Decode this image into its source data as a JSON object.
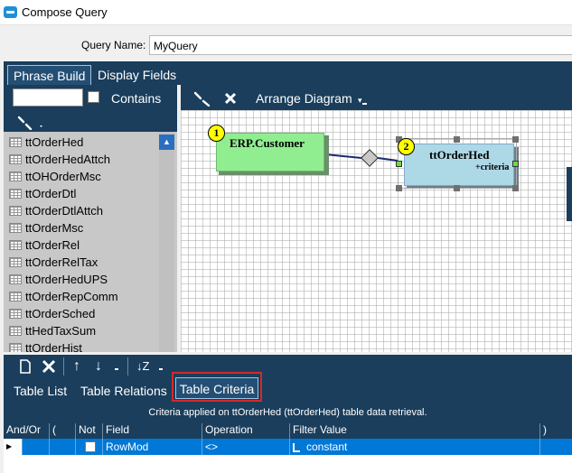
{
  "window": {
    "title": "Compose Query"
  },
  "query": {
    "label": "Query Name:",
    "value": "MyQuery"
  },
  "main_tabs": [
    {
      "label": "Phrase Build",
      "active": true
    },
    {
      "label": "Display Fields",
      "active": false
    }
  ],
  "left": {
    "contains_label": "Contains",
    "tables": [
      "ttOrderHed",
      "ttOrderHedAttch",
      "ttOHOrderMsc",
      "ttOrderDtl",
      "ttOrderDtlAttch",
      "ttOrderMsc",
      "ttOrderRel",
      "ttOrderRelTax",
      "ttOrderHedUPS",
      "ttOrderRepComm",
      "ttOrderSched",
      "ttHedTaxSum",
      "ttOrderHist"
    ]
  },
  "diagram": {
    "toolbar": {
      "arrange_label": "Arrange Diagram"
    },
    "nodes": [
      {
        "num": "1",
        "name": "ERP.Customer",
        "color": "#90ee90"
      },
      {
        "num": "2",
        "name": "ttOrderHed",
        "sub": "+criteria",
        "color": "#add8e6"
      }
    ]
  },
  "sub_tabs": [
    {
      "label": "Table List"
    },
    {
      "label": "Table Relations"
    },
    {
      "label": "Table Criteria",
      "active": true
    }
  ],
  "criteria": {
    "caption": "Criteria applied on ttOrderHed (ttOrderHed)  table data retrieval.",
    "columns": [
      "And/Or",
      "(",
      "Not",
      "Field",
      "Operation",
      "Filter Value",
      ")"
    ],
    "rows": [
      {
        "and_or": "",
        "paren_open": "",
        "not": false,
        "field": "RowMod",
        "operation": "<>",
        "filter_value": "constant",
        "paren_close": ""
      }
    ]
  },
  "colors": {
    "dark_blue": "#1a3e5c",
    "selection": "#0078d7",
    "highlight": "#d42a2a"
  }
}
